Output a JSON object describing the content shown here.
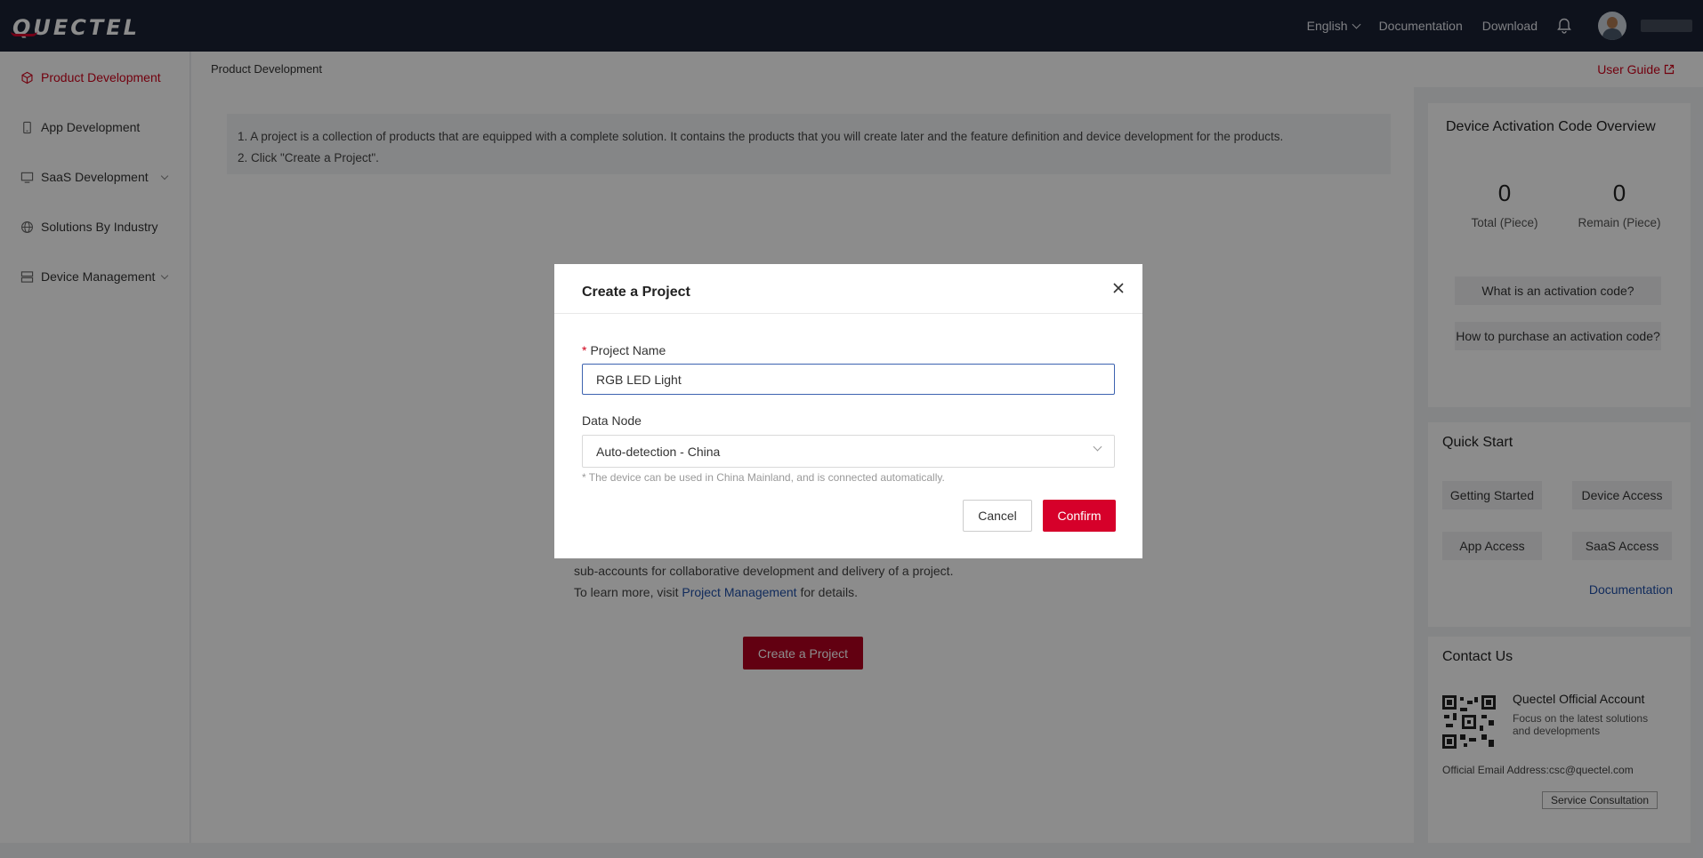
{
  "brand": {
    "logo_text": "QUECTEL",
    "accent": "#d6002a"
  },
  "topnav": {
    "language": "English",
    "documentation": "Documentation",
    "download": "Download"
  },
  "sidebar": {
    "items": [
      {
        "label": "Product Development",
        "icon": "cube-icon",
        "active": true
      },
      {
        "label": "App Development",
        "icon": "phone-icon"
      },
      {
        "label": "SaaS Development",
        "icon": "monitor-icon",
        "expandable": true
      },
      {
        "label": "Solutions By Industry",
        "icon": "globe-icon"
      },
      {
        "label": "Device Management",
        "icon": "server-icon",
        "expandable": true
      }
    ]
  },
  "breadcrumb": {
    "current": "Product Development",
    "user_guide": "User Guide"
  },
  "info": {
    "line1": "1. A project is a collection of products that are equipped with a complete solution. It contains the products that you will create later and the feature definition and device development for the products.",
    "line2": "2. Click \"Create a Project\"."
  },
  "description": {
    "line1": "sub-accounts for collaborative development and delivery of a project.",
    "line2_prefix": "To learn more, visit ",
    "line2_link": "Project Management",
    "line2_suffix": " for details."
  },
  "create_project_button": "Create a Project",
  "activation": {
    "title": "Device Activation Code Overview",
    "total_value": "0",
    "total_label": "Total (Piece)",
    "remain_value": "0",
    "remain_label": "Remain (Piece)",
    "what_btn": "What is an activation code?",
    "how_btn": "How to purchase an activation code?"
  },
  "quick_start": {
    "title": "Quick Start",
    "getting_started": "Getting Started",
    "device_access": "Device Access",
    "app_access": "App Access",
    "saas_access": "SaaS Access",
    "documentation": "Documentation"
  },
  "contact": {
    "title": "Contact Us",
    "official_account": "Quectel Official Account",
    "focus_text": "Focus on the latest solutions and developments",
    "email": "Official Email Address:csc@quectel.com",
    "service_btn": "Service Consultation"
  },
  "modal": {
    "title": "Create a Project",
    "project_name_label": "Project Name",
    "project_name_value": "RGB LED Light",
    "data_node_label": "Data Node",
    "data_node_value": "Auto-detection - China",
    "hint": "* The device can be used in China Mainland, and is connected automatically.",
    "cancel": "Cancel",
    "confirm": "Confirm"
  }
}
